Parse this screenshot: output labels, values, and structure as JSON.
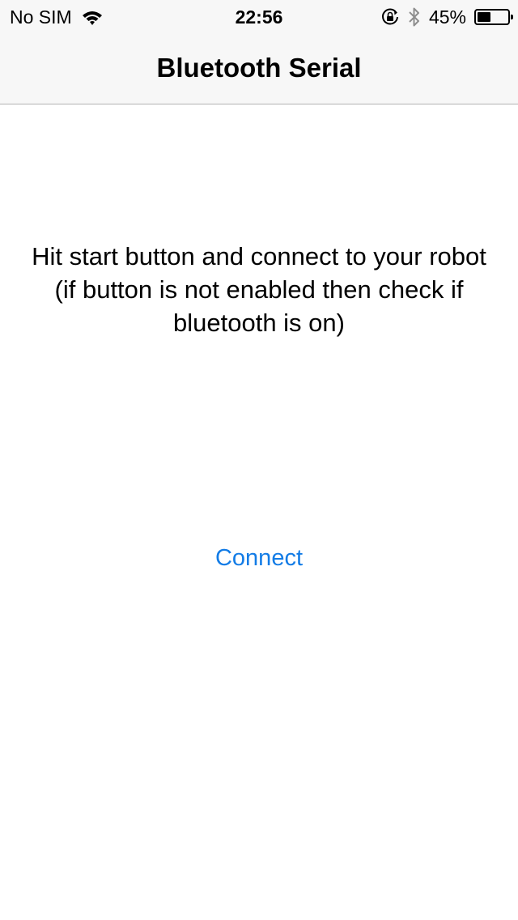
{
  "status_bar": {
    "carrier": "No SIM",
    "wifi_icon": "wifi-icon",
    "time": "22:56",
    "orientation_lock_icon": "orientation-lock-icon",
    "bluetooth_icon": "bluetooth-icon",
    "battery_percent_text": "45%",
    "battery_level": 0.45
  },
  "nav": {
    "title": "Bluetooth Serial"
  },
  "main": {
    "instructions": "Hit start button and connect to your robot (if button is not enabled then check if bluetooth is on)",
    "connect_label": "Connect"
  },
  "colors": {
    "accent": "#137ce6",
    "nav_background": "#f7f7f7",
    "nav_border": "#b2b2b2"
  }
}
